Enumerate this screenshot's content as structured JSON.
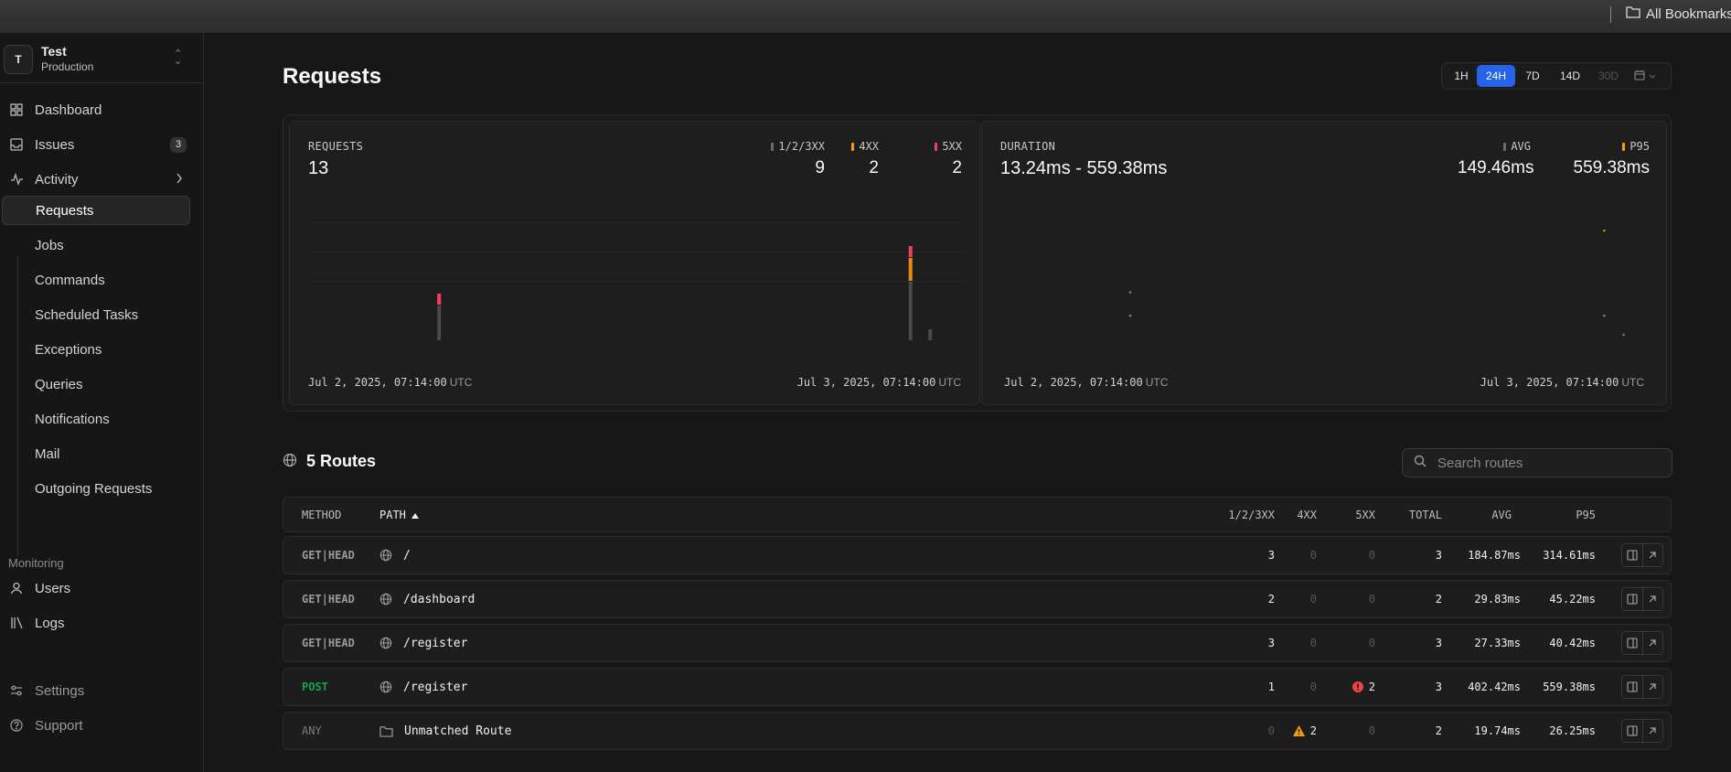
{
  "browser": {
    "bookmarks_label": "All Bookmarks"
  },
  "team": {
    "initial": "T",
    "name": "Test",
    "environment": "Production"
  },
  "nav": {
    "dashboard": "Dashboard",
    "issues": "Issues",
    "issues_count": "3",
    "activity": "Activity",
    "activity_items": [
      "Requests",
      "Jobs",
      "Commands",
      "Scheduled Tasks",
      "Exceptions",
      "Queries",
      "Notifications",
      "Mail",
      "Outgoing Requests"
    ],
    "monitoring_label": "Monitoring",
    "users": "Users",
    "logs": "Logs",
    "settings": "Settings",
    "support": "Support"
  },
  "page": {
    "title": "Requests"
  },
  "range": {
    "options": [
      "1H",
      "24H",
      "7D",
      "14D",
      "30D"
    ],
    "selected": "24H",
    "disabled": [
      "30D"
    ]
  },
  "requests_card": {
    "title": "REQUESTS",
    "total": "13",
    "legend": [
      {
        "label": "1/2/3XX",
        "value": "9",
        "color": "#6b6b6b"
      },
      {
        "label": "4XX",
        "value": "2",
        "color": "#f59e0b"
      },
      {
        "label": "5XX",
        "value": "2",
        "color": "#f43f5e"
      }
    ],
    "axis_start": "Jul 2, 2025, 07:14:00",
    "axis_end": "Jul 3, 2025, 07:14:00",
    "tz": "UTC"
  },
  "duration_card": {
    "title": "DURATION",
    "range": "13.24ms - 559.38ms",
    "legend": [
      {
        "label": "AVG",
        "value": "149.46ms",
        "color": "#6b6b6b"
      },
      {
        "label": "P95",
        "value": "559.38ms",
        "color": "#f59e0b"
      }
    ],
    "axis_start": "Jul 2, 2025, 07:14:00",
    "axis_end": "Jul 3, 2025, 07:14:00",
    "tz": "UTC"
  },
  "chart_data": [
    {
      "type": "bar",
      "title": "REQUESTS",
      "stacked": true,
      "x_range": [
        "Jul 2, 2025, 07:14:00",
        "Jul 3, 2025, 07:14:00"
      ],
      "bars": [
        {
          "position": 0.2,
          "ok": 3,
          "c4xx": 0,
          "c5xx": 1
        },
        {
          "position": 0.92,
          "ok": 5,
          "c4xx": 2,
          "c5xx": 1
        },
        {
          "position": 0.95,
          "ok": 1,
          "c4xx": 0,
          "c5xx": 0
        }
      ],
      "series": [
        {
          "name": "1/2/3XX",
          "color": "#4a4a4a"
        },
        {
          "name": "4XX",
          "color": "#ea8a14"
        },
        {
          "name": "5XX",
          "color": "#f43f5e"
        }
      ]
    },
    {
      "type": "scatter",
      "title": "DURATION",
      "x_range": [
        "Jul 2, 2025, 07:14:00",
        "Jul 3, 2025, 07:14:00"
      ],
      "y_range_ms": [
        13.24,
        559.38
      ],
      "points": [
        {
          "position": 0.2,
          "value_ms": 230,
          "series": "AVG"
        },
        {
          "position": 0.2,
          "value_ms": 120,
          "series": "AVG"
        },
        {
          "position": 0.93,
          "value_ms": 520,
          "series": "P95"
        },
        {
          "position": 0.93,
          "value_ms": 120,
          "series": "AVG"
        },
        {
          "position": 0.96,
          "value_ms": 30,
          "series": "AVG"
        }
      ]
    }
  ],
  "routes": {
    "title": "5 Routes",
    "search_placeholder": "Search routes",
    "columns": {
      "method": "METHOD",
      "path": "PATH",
      "ok": "1/2/3XX",
      "c4xx": "4XX",
      "c5xx": "5XX",
      "total": "TOTAL",
      "avg": "AVG",
      "p95": "P95"
    },
    "rows": [
      {
        "method": "GET|HEAD",
        "kind": "get",
        "icon": "globe",
        "path": "/",
        "ok": "3",
        "c4xx": "0",
        "c5xx": "0",
        "total": "3",
        "avg": "184.87ms",
        "p95": "314.61ms"
      },
      {
        "method": "GET|HEAD",
        "kind": "get",
        "icon": "globe",
        "path": "/dashboard",
        "ok": "2",
        "c4xx": "0",
        "c5xx": "0",
        "total": "2",
        "avg": "29.83ms",
        "p95": "45.22ms"
      },
      {
        "method": "GET|HEAD",
        "kind": "get",
        "icon": "globe",
        "path": "/register",
        "ok": "3",
        "c4xx": "0",
        "c5xx": "0",
        "total": "3",
        "avg": "27.33ms",
        "p95": "40.42ms"
      },
      {
        "method": "POST",
        "kind": "post",
        "icon": "globe",
        "path": "/register",
        "ok": "1",
        "c4xx": "0",
        "c5xx": "2",
        "total": "3",
        "avg": "402.42ms",
        "p95": "559.38ms"
      },
      {
        "method": "ANY",
        "kind": "any",
        "icon": "folder",
        "path": "Unmatched Route",
        "ok": "0",
        "c4xx": "2",
        "c5xx": "0",
        "total": "2",
        "avg": "19.74ms",
        "p95": "26.25ms"
      }
    ]
  }
}
